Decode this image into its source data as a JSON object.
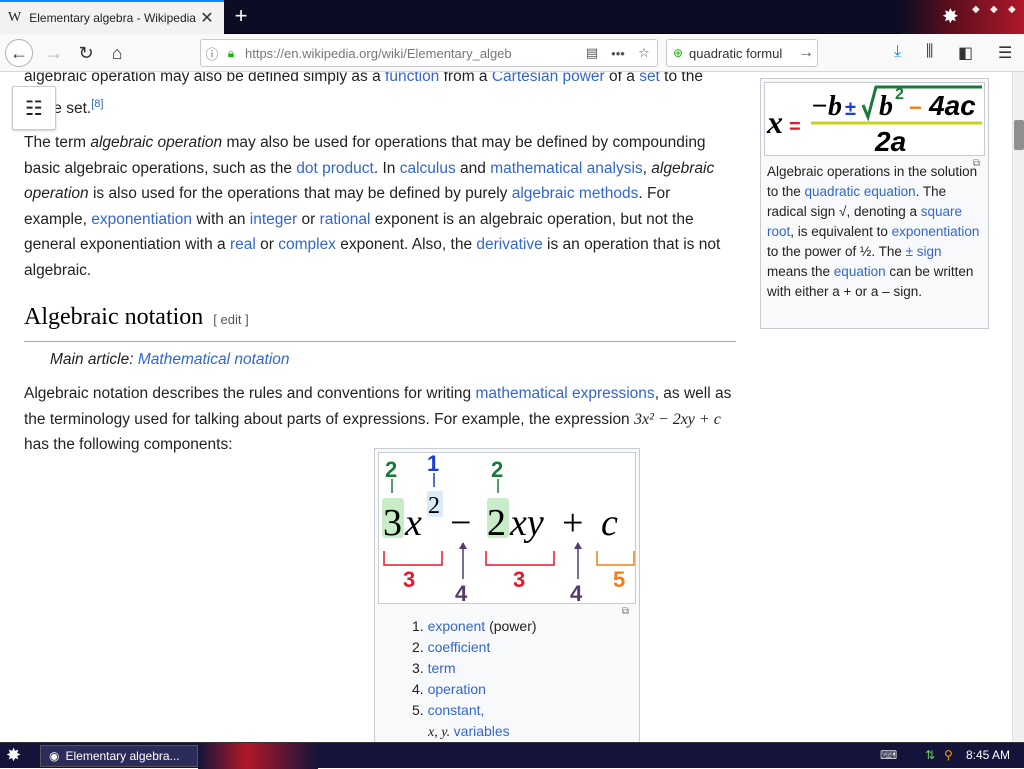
{
  "browser": {
    "tab_title": "Elementary algebra - Wikipedia",
    "tab_logo": "W",
    "url": "https://en.wikipedia.org/wiki/Elementary_algeb",
    "search_text": "quadratic formul"
  },
  "article": {
    "para0_a": "algebraic operation may also be defined simply as a ",
    "para0_link1": "function",
    "para0_b": " from a ",
    "para0_link2": "Cartesian power",
    "para0_c": " of a ",
    "para0_link3": "set",
    "para0_d": " to the",
    "para0_line2": "same set.",
    "para0_ref": "[8]",
    "p1": [
      {
        "t": "The term "
      },
      {
        "t": "algebraic operation",
        "i": true
      },
      {
        "t": " may also be used for operations that may be defined by compounding basic algebraic operations, such as the "
      },
      {
        "t": "dot product",
        "l": true
      },
      {
        "t": ". In "
      },
      {
        "t": "calculus",
        "l": true
      },
      {
        "t": " and "
      },
      {
        "t": "mathematical analysis",
        "l": true
      },
      {
        "t": ", "
      },
      {
        "t": "algebraic operation",
        "i": true
      },
      {
        "t": " is also used for the operations that may be defined by purely "
      },
      {
        "t": "algebraic methods",
        "l": true
      },
      {
        "t": ". For example, "
      },
      {
        "t": "exponentiation",
        "l": true
      },
      {
        "t": " with an "
      },
      {
        "t": "integer",
        "l": true
      },
      {
        "t": " or "
      },
      {
        "t": "rational",
        "l": true
      },
      {
        "t": " exponent is an algebraic operation, but not the general exponentiation with a "
      },
      {
        "t": "real",
        "l": true
      },
      {
        "t": " or "
      },
      {
        "t": "complex",
        "l": true
      },
      {
        "t": " exponent. Also, the "
      },
      {
        "t": "derivative",
        "l": true
      },
      {
        "t": " is an operation that is not algebraic."
      }
    ],
    "heading": "Algebraic notation",
    "edit_label": "[ edit ]",
    "main_article_prefix": "Main article: ",
    "main_article_link": "Mathematical notation",
    "p2": [
      {
        "t": "Algebraic notation describes the rules and conventions for writing "
      },
      {
        "t": "mathematical expressions",
        "l": true
      },
      {
        "t": ", as well as the terminology used for talking about parts of expressions. For example, the expression "
      },
      {
        "t": "3x² − 2xy + c",
        "m": true
      },
      {
        "t": " has the following components:"
      }
    ]
  },
  "infobox": {
    "formula_lhs": "x =",
    "formula_num_b": "−b",
    "formula_pm": "±",
    "formula_radicand_b": "b",
    "formula_radicand_exp": "2",
    "formula_radicand_minus": "−",
    "formula_radicand_4ac": "4ac",
    "formula_den": "2a",
    "caption": [
      {
        "t": "Algebraic operations in the solution to the "
      },
      {
        "t": "quadratic equation",
        "l": true
      },
      {
        "t": ". The radical sign √, denoting a "
      },
      {
        "t": "square root",
        "l": true
      },
      {
        "t": ", is equivalent to "
      },
      {
        "t": "exponentiation",
        "l": true
      },
      {
        "t": " to the power of ½. The "
      },
      {
        "t": "± sign",
        "l": true
      },
      {
        "t": " means the "
      },
      {
        "t": "equation",
        "l": true
      },
      {
        "t": " can be written with either a + or a – sign."
      }
    ]
  },
  "figure": {
    "expr_3": "3",
    "expr_x": "x",
    "expr_exp": "2",
    "expr_minus": "−",
    "expr_2": "2",
    "expr_xy": "xy",
    "expr_plus": "+",
    "expr_c": "c",
    "label_exp": "1",
    "label_coef_a": "2",
    "label_coef_b": "2",
    "label_term_a": "3",
    "label_term_b": "3",
    "label_op_a": "4",
    "label_op_b": "4",
    "label_const": "5",
    "items": [
      {
        "num": "1.",
        "link": "exponent",
        "rest": " (power)"
      },
      {
        "num": "2.",
        "link": "coefficient",
        "rest": ""
      },
      {
        "num": "3.",
        "link": "term",
        "rest": ""
      },
      {
        "num": "4.",
        "link": "operation",
        "rest": ""
      },
      {
        "num": "5.",
        "link": "constant,",
        "rest": ""
      }
    ],
    "item5_line2_math": "x, y.",
    "item5_line2_link": "variables"
  },
  "taskbar": {
    "task_label": "Elementary algebra...",
    "clock": "8:45 AM"
  },
  "colors": {
    "link": "#3366cc",
    "green": "#1a7a3a",
    "blue": "#1a3fd1",
    "red": "#e3182d",
    "orange": "#f07d1a",
    "purple": "#553a6b"
  },
  "icons": [
    "back-arrow-icon",
    "forward-arrow-icon",
    "reload-icon",
    "home-icon",
    "info-icon",
    "lock-icon",
    "reader-view-icon",
    "page-actions-icon",
    "bookmark-star-icon",
    "search-engine-icon",
    "go-arrow-icon",
    "download-icon",
    "library-icon",
    "sidebar-icon",
    "menu-icon",
    "toc-icon",
    "enlarge-icon",
    "start-icon",
    "clock-icon"
  ]
}
